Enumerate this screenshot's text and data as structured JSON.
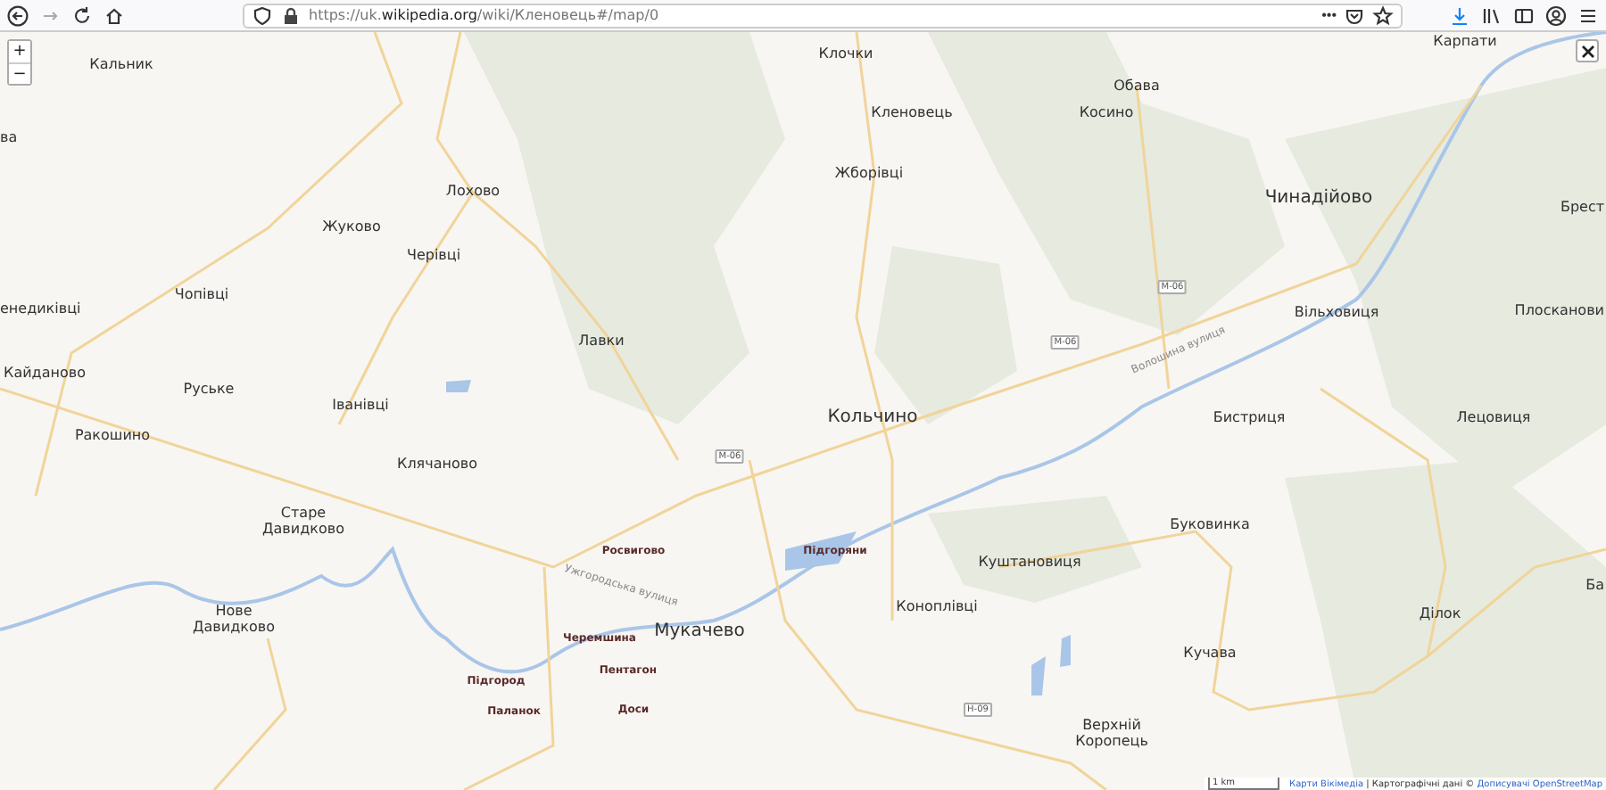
{
  "toolbar": {
    "url": "https://uk.**wikipedia.org**/wiki/Кленовець#/map/0",
    "more": "•••"
  },
  "map": {
    "zoom_in": "+",
    "zoom_out": "−",
    "places": [
      {
        "name": "Кальник",
        "kind": "village"
      },
      {
        "name": "ва",
        "kind": "village"
      },
      {
        "name": "Клочки",
        "kind": "village"
      },
      {
        "name": "Обава",
        "kind": "village"
      },
      {
        "name": "Кленовець",
        "kind": "village"
      },
      {
        "name": "Косино",
        "kind": "village"
      },
      {
        "name": "Карпати",
        "kind": "village"
      },
      {
        "name": "Жборівці",
        "kind": "village"
      },
      {
        "name": "Лохово",
        "kind": "village"
      },
      {
        "name": "Чинадійово",
        "kind": "town"
      },
      {
        "name": "Брест",
        "kind": "village"
      },
      {
        "name": "Жуково",
        "kind": "village"
      },
      {
        "name": "Черівці",
        "kind": "village"
      },
      {
        "name": "Чопівці",
        "kind": "village"
      },
      {
        "name": "енедиківці",
        "kind": "village"
      },
      {
        "name": "Вільховиця",
        "kind": "village"
      },
      {
        "name": "Плосканови",
        "kind": "village"
      },
      {
        "name": "Лавки",
        "kind": "village"
      },
      {
        "name": "Кайданово",
        "kind": "village"
      },
      {
        "name": "Руське",
        "kind": "village"
      },
      {
        "name": "Іванівці",
        "kind": "village"
      },
      {
        "name": "Кольчино",
        "kind": "town"
      },
      {
        "name": "Бистриця",
        "kind": "village"
      },
      {
        "name": "Лецовиця",
        "kind": "village"
      },
      {
        "name": "Ракошино",
        "kind": "village"
      },
      {
        "name": "Клячаново",
        "kind": "village"
      },
      {
        "name": "Старе Давидково",
        "kind": "village"
      },
      {
        "name": "Буковинка",
        "kind": "village"
      },
      {
        "name": "Росвигово",
        "kind": "district"
      },
      {
        "name": "Підгоряни",
        "kind": "district"
      },
      {
        "name": "Куштановиця",
        "kind": "village"
      },
      {
        "name": "Ба",
        "kind": "village"
      },
      {
        "name": "Нове Давидково",
        "kind": "village"
      },
      {
        "name": "Коноплівці",
        "kind": "village"
      },
      {
        "name": "Дiлок",
        "kind": "village"
      },
      {
        "name": "Черемшина",
        "kind": "district"
      },
      {
        "name": "Мукачево",
        "kind": "town"
      },
      {
        "name": "Кучава",
        "kind": "village"
      },
      {
        "name": "Пентагон",
        "kind": "district"
      },
      {
        "name": "Підгород",
        "kind": "district"
      },
      {
        "name": "Паланок",
        "kind": "district"
      },
      {
        "name": "Доси",
        "kind": "district"
      },
      {
        "name": "Верхній Коропець",
        "kind": "village"
      }
    ],
    "streets": [
      {
        "name": "Ужгородська вулиця"
      },
      {
        "name": "Волошина вулиця"
      }
    ],
    "road_badges": [
      {
        "label": "M-06"
      },
      {
        "label": "M-06"
      },
      {
        "label": "M-06"
      },
      {
        "label": "H-09"
      }
    ],
    "scale": "1 km",
    "attribution": {
      "maps": "Карти Вікімедіа",
      "separator": " | Картографічні дані © ",
      "osm": "Дописувачі OpenStreetMap"
    }
  }
}
